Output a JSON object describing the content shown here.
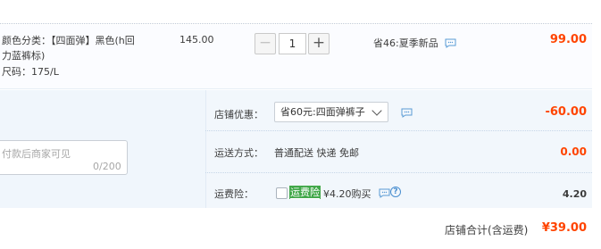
{
  "item": {
    "spec_color_prefix": "颜色分类：",
    "spec_color_value_line1": "【四面弹】黑色(h回",
    "spec_color_value_line2": "力蓝裤标)",
    "spec_size": "尺码：175/L",
    "unit_price": "145.00",
    "quantity": "1",
    "minus_label": "−",
    "plus_label": "+",
    "promo": "省46:夏季新品",
    "subtotal": "99.00"
  },
  "memo": {
    "placeholder": "付款后商家可见",
    "counter": "0/200"
  },
  "shop_discount": {
    "label": "店铺优惠：",
    "selected": "省60元:四面弹裤子",
    "amount": "-60.00"
  },
  "shipping": {
    "label": "运送方式：",
    "method": "普通配送 快递 免邮",
    "fee": "0.00"
  },
  "insurance": {
    "label": "运费险：",
    "badge": "运费险",
    "price": "¥4.20购买",
    "help_glyph": "?",
    "fee": "4.20"
  },
  "shop_total": {
    "label": "店铺合计(含运费)",
    "amount": "¥39.00"
  },
  "colors": {
    "accent_price": "#ff4400",
    "panel_bg": "#f0f6fc",
    "badge_green": "#42a84a"
  }
}
